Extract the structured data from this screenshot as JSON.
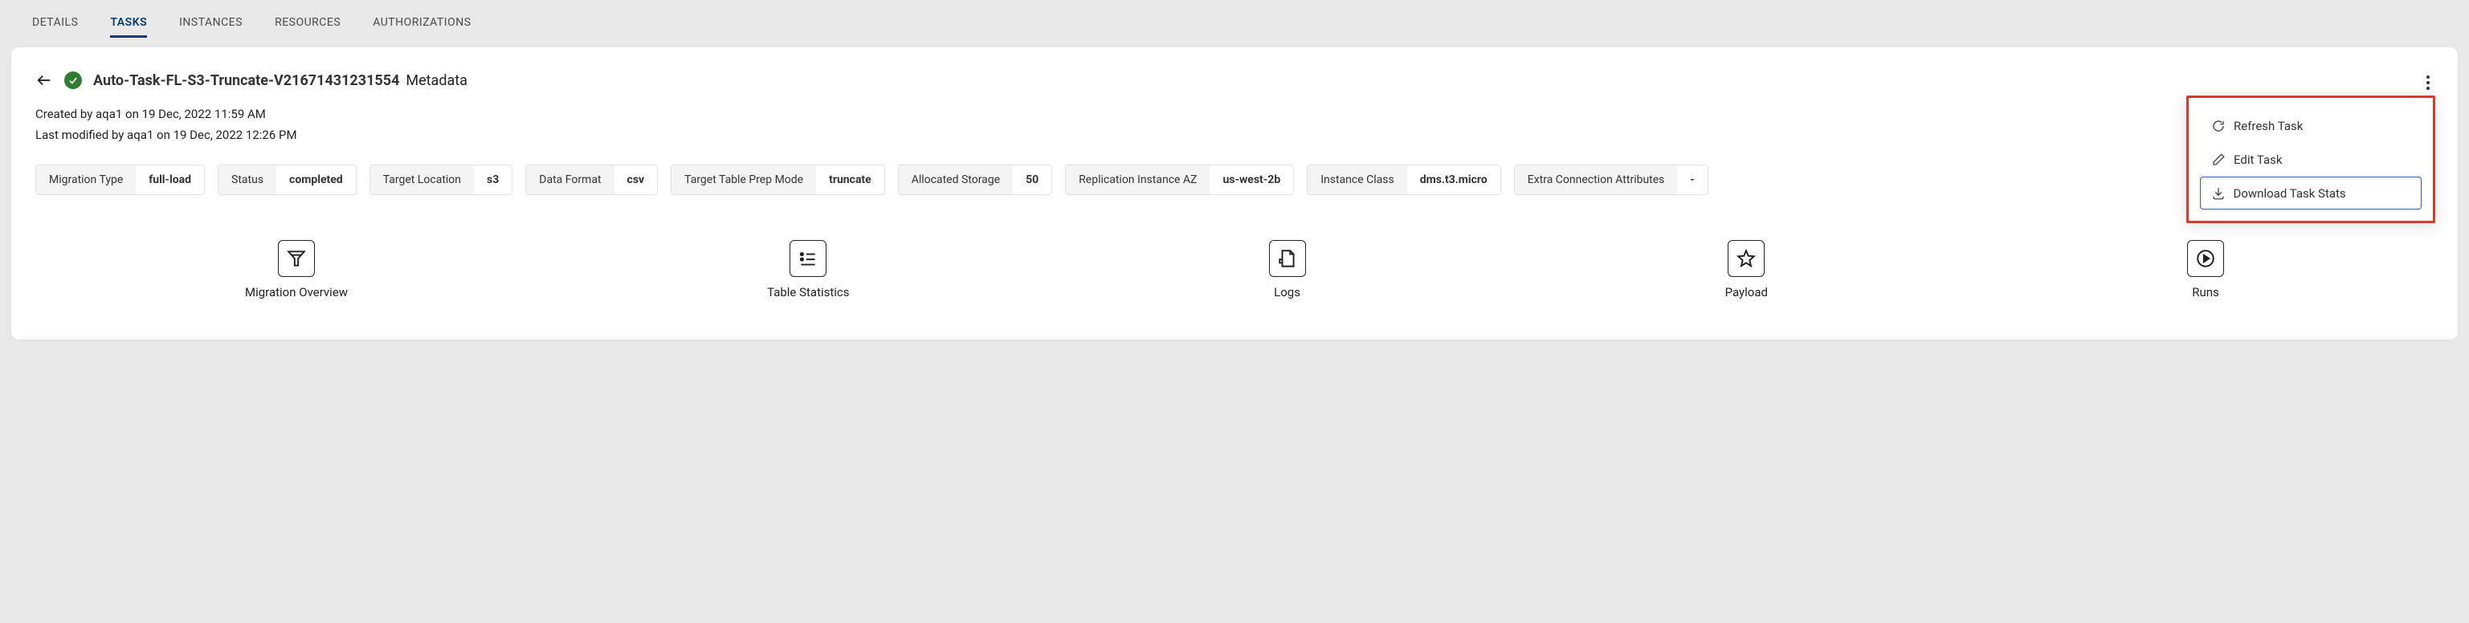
{
  "tabs": {
    "details": "DETAILS",
    "tasks": "TASKS",
    "instances": "INSTANCES",
    "resources": "RESOURCES",
    "authorizations": "AUTHORIZATIONS"
  },
  "header": {
    "title_bold": "Auto-Task-FL-S3-Truncate-V21671431231554",
    "title_light": "Metadata"
  },
  "meta": {
    "created": "Created by aqa1 on 19 Dec, 2022 11:59 AM",
    "modified": "Last modified by aqa1 on 19 Dec, 2022 12:26 PM"
  },
  "chips": [
    {
      "label": "Migration Type",
      "value": "full-load"
    },
    {
      "label": "Status",
      "value": "completed"
    },
    {
      "label": "Target Location",
      "value": "s3"
    },
    {
      "label": "Data Format",
      "value": "csv"
    },
    {
      "label": "Target Table Prep Mode",
      "value": "truncate"
    },
    {
      "label": "Allocated Storage",
      "value": "50"
    },
    {
      "label": "Replication Instance AZ",
      "value": "us-west-2b"
    },
    {
      "label": "Instance Class",
      "value": "dms.t3.micro"
    },
    {
      "label": "Extra Connection Attributes",
      "value": "-"
    }
  ],
  "kpis": {
    "migration": "Migration Overview",
    "tablestats": "Table Statistics",
    "logs": "Logs",
    "payload": "Payload",
    "runs": "Runs"
  },
  "dropdown": {
    "refresh": "Refresh Task",
    "edit": "Edit Task",
    "download": "Download Task Stats"
  }
}
